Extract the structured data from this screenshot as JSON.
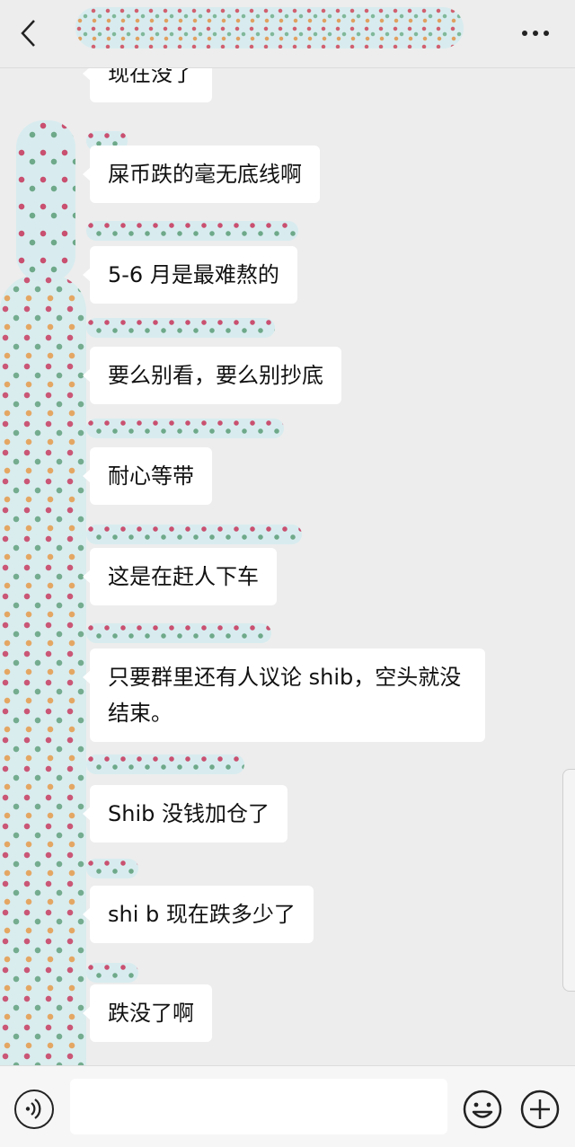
{
  "header": {
    "back_icon": "chevron-left-icon",
    "more_icon": "ellipsis-icon"
  },
  "messages": [
    {
      "text": "现在没了"
    },
    {
      "text": "屎币跌的毫无底线啊"
    },
    {
      "text": "5-6 月是最难熬的"
    },
    {
      "text": "要么别看，要么别抄底"
    },
    {
      "text": "耐心等带"
    },
    {
      "text": "这是在赶人下车"
    },
    {
      "text": "只要群里还有人议论 shib，空头就没结束。"
    },
    {
      "text": "Shib 没钱加仓了"
    },
    {
      "text": "shi b 现在跌多少了"
    },
    {
      "text": "跌没了啊"
    }
  ],
  "input_bar": {
    "voice_icon": "voice-icon",
    "emoji_icon": "emoji-icon",
    "plus_icon": "plus-icon"
  },
  "colors": {
    "background": "#ededed",
    "bubble": "#ffffff",
    "text": "#111111"
  }
}
